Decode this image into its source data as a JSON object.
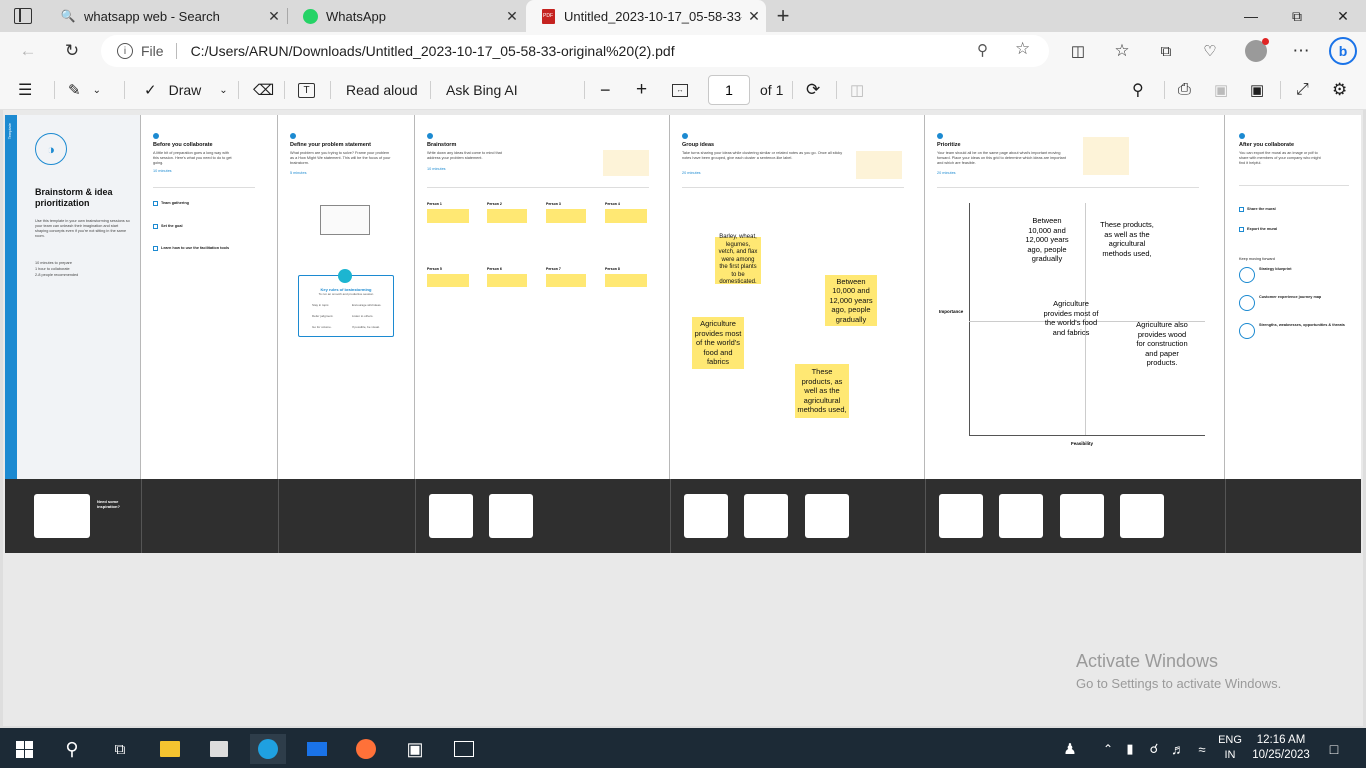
{
  "tabs": [
    {
      "title": "whatsapp web - Search",
      "icon": "search-icon"
    },
    {
      "title": "WhatsApp",
      "icon": "whatsapp-icon"
    },
    {
      "title": "Untitled_2023-10-17_05-58-33-o",
      "icon": "pdf-icon",
      "active": true
    }
  ],
  "address": {
    "file_label": "File",
    "url": "C:/Users/ARUN/Downloads/Untitled_2023-10-17_05-58-33-original%20(2).pdf"
  },
  "pdf_toolbar": {
    "draw_label": "Draw",
    "read_aloud_label": "Read aloud",
    "ask_bing_label": "Ask Bing AI",
    "page_number": "1",
    "page_total": "of 1"
  },
  "doc": {
    "template_tag": "Template",
    "title": "Brainstorm & idea prioritization",
    "intro": "Use this template in your own brainstorming sessions so your team can unleash their imagination and start shaping concepts even if you're not sitting in the same room.",
    "stats": [
      "10 minutes to prepare",
      "1 hour to collaborate",
      "2-8 people recommended"
    ],
    "steps": [
      {
        "title": "Before you collaborate",
        "desc": "A little bit of preparation goes a long way with this session. Here's what you need to do to get going.",
        "time": "10 minutes"
      },
      {
        "title": "Define your problem statement",
        "desc": "What problem are you trying to solve? Frame your problem as a How Might We statement. This will be the focus of your brainstorm.",
        "time": "5 minutes"
      },
      {
        "title": "Brainstorm",
        "desc": "Write down any ideas that come to mind that address your problem statement.",
        "time": "10 minutes"
      },
      {
        "title": "Group ideas",
        "desc": "Take turns sharing your ideas while clustering similar or related notes as you go. Once all sticky notes have been grouped, give each cluster a sentence-like label.",
        "time": "20 minutes"
      },
      {
        "title": "Prioritize",
        "desc": "Your team should all be on the same page about what's important moving forward. Place your ideas on this grid to determine which ideas are important and which are feasible.",
        "time": "20 minutes"
      },
      {
        "title": "After you collaborate",
        "desc": "You can export the mural as an image or pdf to share with members of your company who might find it helpful."
      }
    ],
    "prep_items": [
      "Team gathering",
      "Set the goal",
      "Learn how to use the facilitation tools"
    ],
    "rules_title": "Key rules of brainstorming",
    "rules_sub": "To run an smooth and productive session",
    "rules": [
      "Stay in topic.",
      "Encourage wild ideas.",
      "Defer judgment.",
      "Listen to others.",
      "Go for volume.",
      "If possible, be visual."
    ],
    "persons": [
      "Person 1",
      "Person 2",
      "Person 3",
      "Person 4",
      "Person 5",
      "Person 6",
      "Person 7",
      "Person 8"
    ],
    "group_notes": [
      "Barley, wheat, legumes, vetch, and flax were among the first plants to be domesticated.",
      "Between 10,000 and 12,000 years ago, people gradually",
      "Agriculture provides most of the world's food and fabrics",
      "These products, as well as the agricultural methods used,"
    ],
    "prio_notes": [
      "Between 10,000 and 12,000 years ago, people gradually",
      "These products, as well as the agricultural methods used,",
      "Agriculture provides most of the world's food and fabrics",
      "Agriculture also provides wood for construction and paper products."
    ],
    "axis_y": "Importance",
    "axis_x": "Feasibility",
    "after_items": [
      "Share the mural",
      "Export the mural"
    ],
    "keep_moving": "Keep moving forward",
    "next_templates": [
      "Strategy blueprint",
      "Customer experience journey map",
      "Strengths, weaknesses, opportunities & threats"
    ],
    "need_inspiration": "Need some inspiration?"
  },
  "watermark": {
    "line1": "Activate Windows",
    "line2": "Go to Settings to activate Windows."
  },
  "taskbar": {
    "lang1": "ENG",
    "lang2": "IN",
    "time": "12:16 AM",
    "date": "10/25/2023"
  }
}
